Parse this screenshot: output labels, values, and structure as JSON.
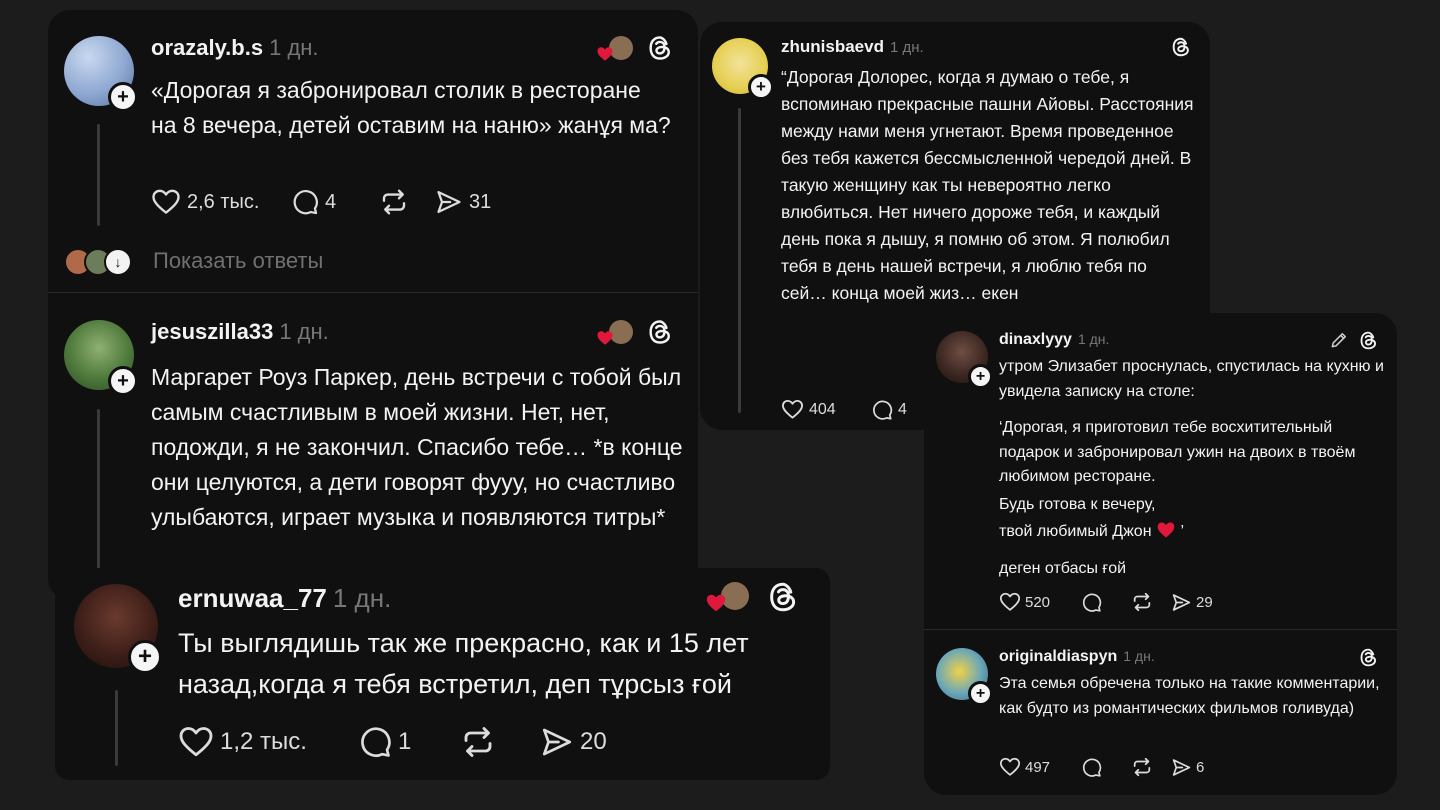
{
  "colors": {
    "background": "#1c1c1c",
    "card": "#101010",
    "heart": "#e0183c",
    "muted": "#777777"
  },
  "post1": {
    "username": "orazaly.b.s",
    "time": "1 дн.",
    "text": "«Дорогая я забронировал столик в ресторане на 8 вечера, детей оставим на наню» жанұя ма?",
    "likes": "2,6 тыс.",
    "replies": "4",
    "shares": "31",
    "show_replies": "Показать ответы"
  },
  "post2": {
    "username": "jesuszilla33",
    "time": "1 дн.",
    "text": "Маргарет Роуз Паркер, день встречи с тобой был самым счастливым в моей жизни. Нет, нет, подожди, я не закончил. Спасибо тебе… *в конце они целуются, а дети говорят фууу, но счастливо улыбаются, играет музыка и появляются титры*"
  },
  "post3": {
    "username": "ernuwaa_77",
    "time": "1 дн.",
    "text": "Ты выглядишь так же прекрасно, как и 15 лет назад,когда я тебя встретил, деп тұрсыз ғой",
    "likes": "1,2 тыс.",
    "replies": "1",
    "shares": "20"
  },
  "post4": {
    "username": "zhunisbaevd",
    "time": "1 дн.",
    "text": "“Дорогая Долорес, когда я думаю о тебе, я вспоминаю прекрасные пашни Айовы. Расстояния между нами меня угнетают. Время проведенное без тебя кажется бессмысленной чередой дней. В такую женщину как ты невероятно легко влюбиться. Нет ничего дороже тебя, и каждый день пока я дышу, я помню об этом. Я полюбил тебя в день нашей встречи, я люблю тебя по сей… конца моей жиз… екен",
    "likes": "404",
    "replies": "4"
  },
  "post5": {
    "username": "dinaxlyyy",
    "time": "1 дн.",
    "line1": "утром Элизабет проснулась, спустилась на кухню и увидела записку на столе:",
    "line2": "‘Дорогая, я приготовил тебе восхитительный подарок и забронировал ужин на двоих в твоём любимом ресторане.",
    "line3": "Будь готова к вечеру,",
    "line4": "твой любимый Джон",
    "line4_end": "’",
    "line5": "деген отбасы ғой",
    "likes": "520",
    "shares": "29"
  },
  "post6": {
    "username": "originaldiaspyn",
    "time": "1 дн.",
    "text": "Эта семья обречена только на такие комментарии, как будто из романтических фильмов голивуда)",
    "likes": "497",
    "shares": "6"
  },
  "icons": [
    "heart-icon",
    "comment-icon",
    "repost-icon",
    "share-icon",
    "threads-logo-icon",
    "edit-icon",
    "plus-icon",
    "arrow-down-icon"
  ]
}
